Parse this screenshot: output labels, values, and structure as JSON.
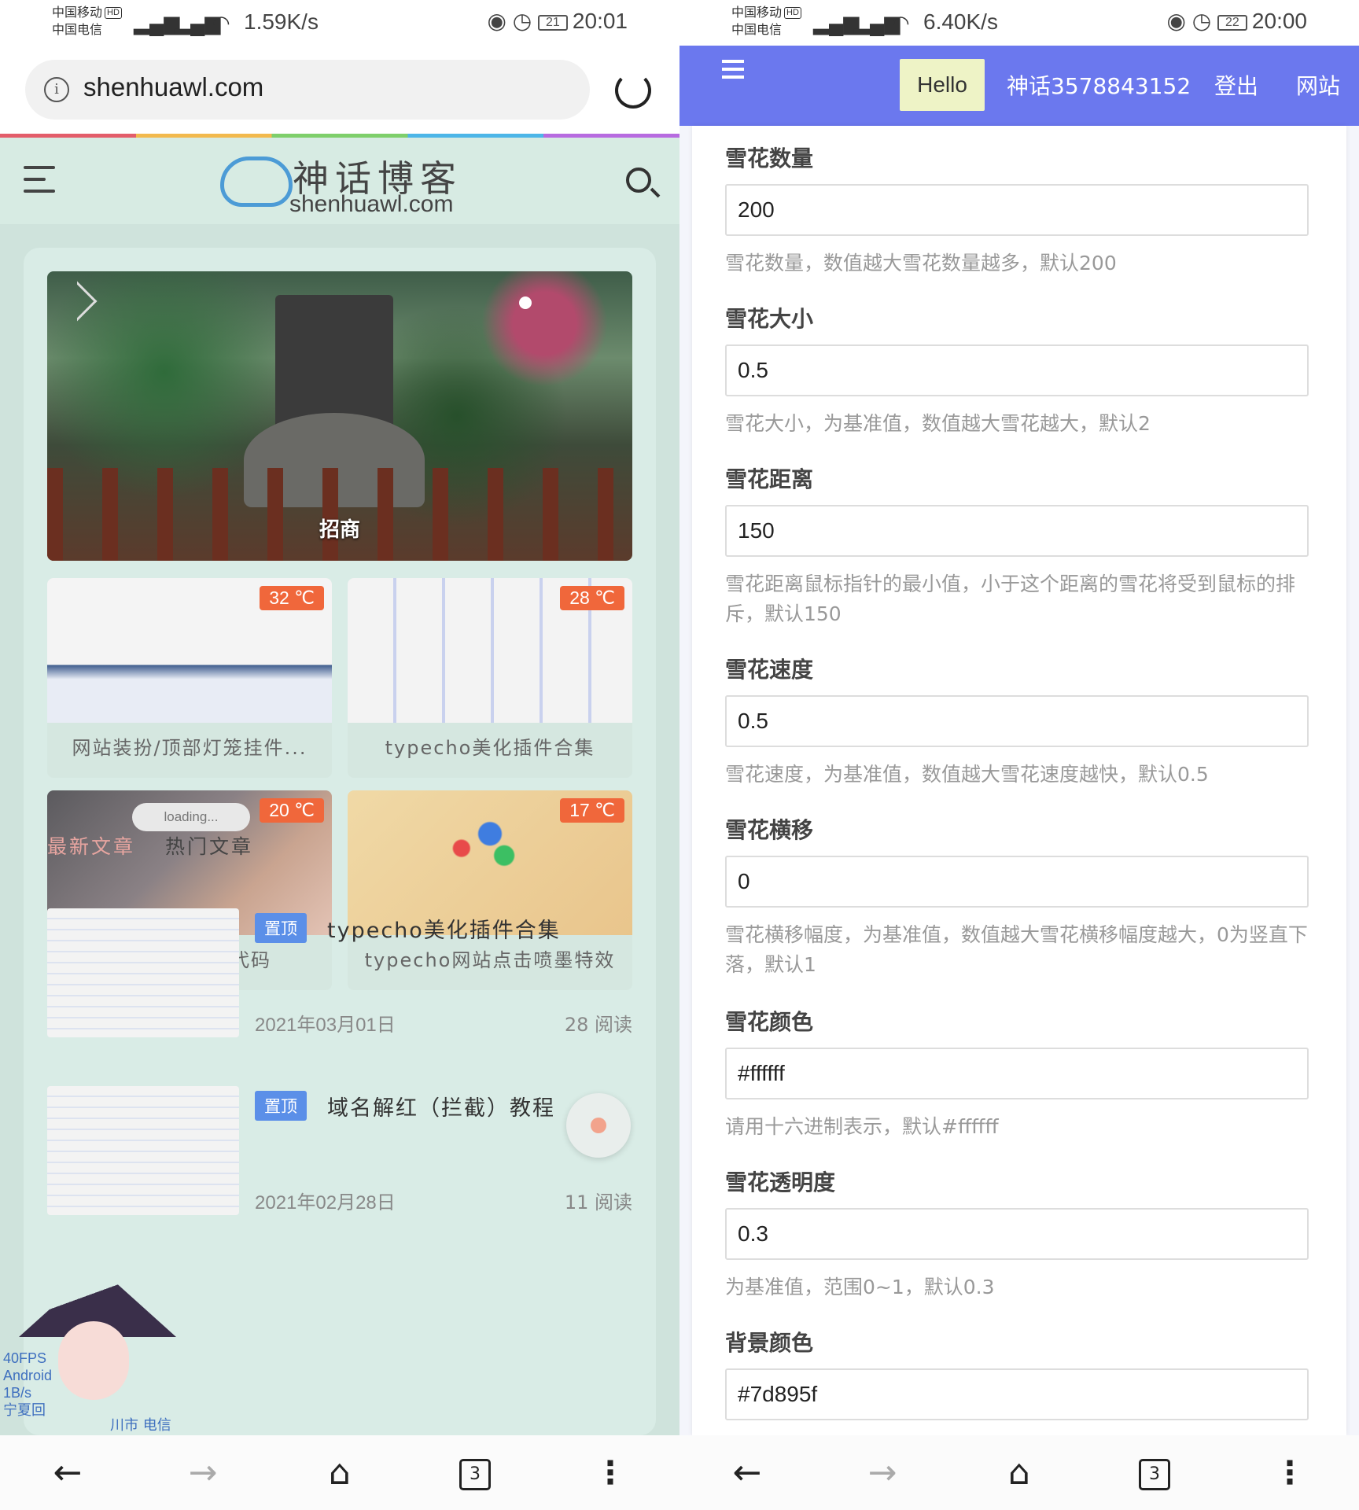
{
  "left": {
    "status": {
      "carrier1": "中国移动",
      "carrier2": "中国电信",
      "hd": "HD",
      "net": "1.59K/s",
      "battery": "21",
      "time": "20:01"
    },
    "url": "shenhuawl.com",
    "site": {
      "logo_cn": "神话博客",
      "logo_en": "shenhuawl.com",
      "banner_caption": "招商",
      "tiles": [
        {
          "title": "网站装扮/顶部灯笼挂件...",
          "temp": "32 ℃"
        },
        {
          "title": "typecho美化插件合集",
          "temp": "28 ℃"
        },
        {
          "title": "网站运行天数代码",
          "temp": "20 ℃",
          "loading": "loading..."
        },
        {
          "title": "typecho网站点击喷墨特效",
          "temp": "17 ℃"
        }
      ],
      "tabs": {
        "latest": "最新文章",
        "hot": "热门文章"
      },
      "posts": [
        {
          "badge": "置顶",
          "title": "typecho美化插件合集",
          "date": "2021年03月01日",
          "reads": "28 阅读"
        },
        {
          "badge": "置顶",
          "title": "域名解红（拦截）教程",
          "date": "2021年02月28日",
          "reads": "11 阅读"
        }
      ],
      "overlay": {
        "fps": "40FPS",
        "os": "Android",
        "size": "1B/s",
        "location": "宁夏回",
        "carrier": "川市 电信"
      }
    },
    "nav": {
      "tabs_count": "3"
    }
  },
  "right": {
    "status": {
      "carrier1": "中国移动",
      "carrier2": "中国电信",
      "hd": "HD",
      "net": "6.40K/s",
      "battery": "22",
      "time": "20:00"
    },
    "topbar": {
      "hello": "Hello",
      "user": "神话3578843152",
      "logout": "登出",
      "site": "网站"
    },
    "fields": [
      {
        "label": "雪花数量",
        "value": "200",
        "help": "雪花数量，数值越大雪花数量越多，默认200"
      },
      {
        "label": "雪花大小",
        "value": "0.5",
        "help": "雪花大小，为基准值，数值越大雪花越大，默认2"
      },
      {
        "label": "雪花距离",
        "value": "150",
        "help": "雪花距离鼠标指针的最小值，小于这个距离的雪花将受到鼠标的排斥，默认150"
      },
      {
        "label": "雪花速度",
        "value": "0.5",
        "help": "雪花速度，为基准值，数值越大雪花速度越快，默认0.5"
      },
      {
        "label": "雪花横移",
        "value": "0",
        "help": "雪花横移幅度，为基准值，数值越大雪花横移幅度越大，0为竖直下落，默认1"
      },
      {
        "label": "雪花颜色",
        "value": "#ffffff",
        "help": "请用十六进制表示，默认#ffffff"
      },
      {
        "label": "雪花透明度",
        "value": "0.3",
        "help": "为基准值，范围0~1，默认0.3"
      },
      {
        "label": "背景颜色",
        "value": "#7d895f",
        "help": ""
      }
    ],
    "nav": {
      "tabs_count": "3"
    }
  },
  "colors": {
    "topbar": "#6b78ee",
    "badge": "#5b8fe8",
    "temp": "#f0673b",
    "site_bg": "#cfe3dc"
  },
  "icons": [
    "info-icon",
    "reload-icon",
    "menu-icon",
    "search-icon",
    "send-icon",
    "back-icon",
    "forward-icon",
    "home-icon",
    "tabs-icon",
    "more-icon"
  ]
}
